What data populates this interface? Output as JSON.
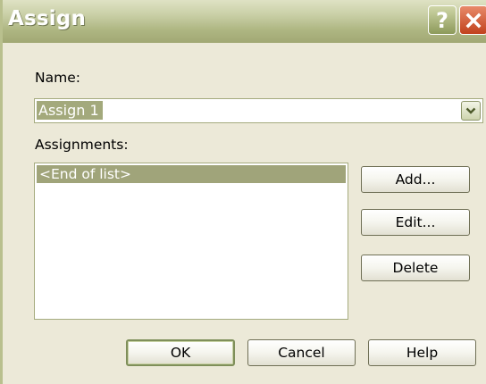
{
  "dialog": {
    "title": "Assign",
    "help_button": "?",
    "name_label": "Name:",
    "name_value": "Assign 1",
    "assignments_label": "Assignments:",
    "assignments": [
      "<End of list>"
    ],
    "buttons": {
      "add": "Add...",
      "edit": "Edit...",
      "delete": "Delete",
      "ok": "OK",
      "cancel": "Cancel",
      "help": "Help"
    }
  },
  "icons": {
    "help": "question-mark-icon",
    "close": "close-icon",
    "dropdown": "chevron-down-icon"
  },
  "colors": {
    "titlebar": "#aeb682",
    "selection": "#a0a47a",
    "close": "#c1421d",
    "dialog_bg": "#ece9d8"
  }
}
